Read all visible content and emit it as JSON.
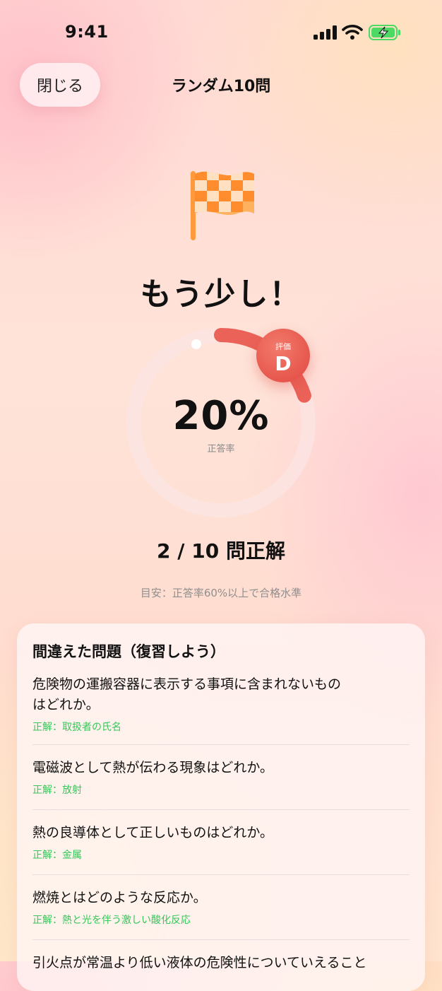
{
  "status_bar": {
    "time": "9:41"
  },
  "header": {
    "close_label": "閉じる",
    "title": "ランダム10問"
  },
  "result": {
    "headline": "もう少し！",
    "percent": "20%",
    "percent_label": "正答率",
    "progress_fraction": 0.2,
    "grade_label": "評価",
    "grade_value": "D",
    "score_text": "2 / 10 問正解",
    "hint": "目安：正答率60%以上で合格水準"
  },
  "mistakes": {
    "title": "間違えた問題（復習しよう）",
    "items": [
      {
        "question_line1": "危険物の運搬容器に表示する事項に含まれないもの",
        "question_line2": "はどれか。",
        "answer": "正解：取扱者の氏名"
      },
      {
        "question": "電磁波として熱が伝わる現象はどれか。",
        "answer": "正解：放射"
      },
      {
        "question": "熱の良導体として正しいものはどれか。",
        "answer": "正解：金属"
      },
      {
        "question": "燃焼とはどのような反応か。",
        "answer": "正解：熱と光を伴う激しい酸化反応"
      },
      {
        "question": "引火点が常温より低い液体の危険性についていえること"
      }
    ]
  },
  "colors": {
    "accent": "#e2483f",
    "correct": "#34c759",
    "flag": "#ff9a3c"
  }
}
